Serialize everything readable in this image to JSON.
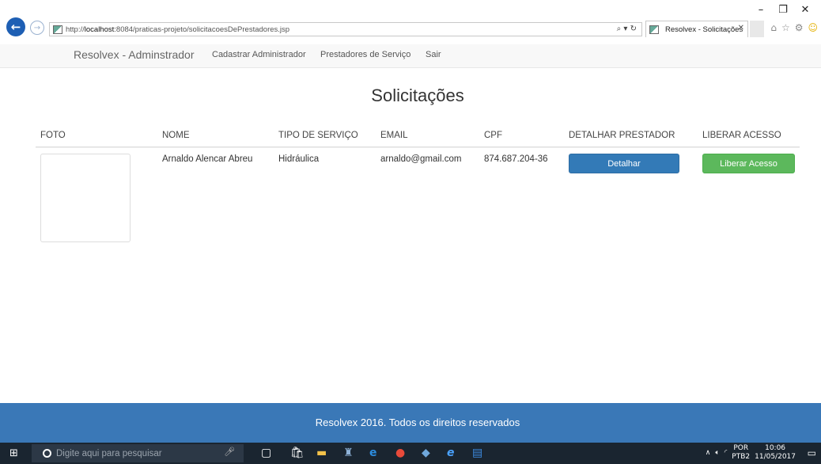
{
  "browser": {
    "url_prefix": "http://",
    "url_host": "localhost",
    "url_rest": ":8084/praticas-projeto/solicitacoesDePrestadores.jsp",
    "tab_title": "Resolvex - Solicitações",
    "window_controls": {
      "minimize": "–",
      "restore": "❐",
      "close": "✕"
    },
    "address_tools": "⌕ ▾ ↻"
  },
  "navbar": {
    "brand": "Resolvex - Adminstrador",
    "links": [
      "Cadastrar Administrador",
      "Prestadores de Serviço",
      "Sair"
    ]
  },
  "page": {
    "title": "Solicitações",
    "columns": [
      "FOTO",
      "NOME",
      "TIPO DE SERVIÇO",
      "EMAIL",
      "CPF",
      "DETALHAR PRESTADOR",
      "LIBERAR ACESSO"
    ],
    "rows": [
      {
        "nome": "Arnaldo Alencar Abreu",
        "tipo": "Hidráulica",
        "email": "arnaldo@gmail.com",
        "cpf": "874.687.204-36",
        "detalhar_label": "Detalhar",
        "liberar_label": "Liberar Acesso"
      }
    ]
  },
  "footer": {
    "text": "Resolvex 2016. Todos os direitos reservados"
  },
  "taskbar": {
    "search_placeholder": "Digite aqui para pesquisar",
    "language": "POR",
    "layout": "PTB2",
    "time": "10:06",
    "date": "11/05/2017"
  },
  "colors": {
    "primary": "#337ab7",
    "success": "#5cb85c",
    "footer": "#3a78b7",
    "taskbar": "#1a2530"
  }
}
